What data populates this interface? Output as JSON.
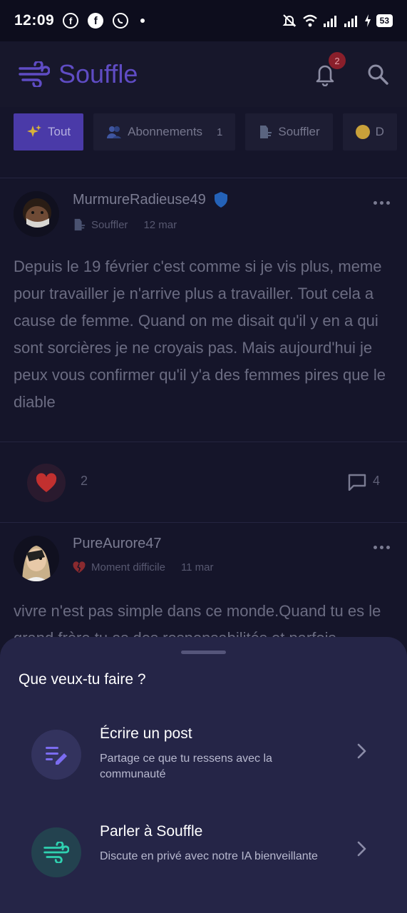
{
  "status_bar": {
    "time": "12:09",
    "battery": "53"
  },
  "header": {
    "title": "Souffle",
    "notification_count": "2"
  },
  "tabs": [
    {
      "label": "Tout",
      "count": ""
    },
    {
      "label": "Abonnements",
      "count": "1"
    },
    {
      "label": "Souffler",
      "count": ""
    },
    {
      "label": "D",
      "count": ""
    }
  ],
  "posts": [
    {
      "author": "MurmureRadieuse49",
      "verified": true,
      "category": "Souffler",
      "date": "12 mar",
      "body": "Depuis le 19 février c'est comme si je vis plus, meme pour travailler je n'arrive plus a travailler. Tout cela a cause de femme. Quand on me disait qu'il y en a qui sont sorcières je ne croyais pas. Mais aujourd'hui je peux vous confirmer qu'il y'a des femmes pires que le diable",
      "likes": "2",
      "comments": "4"
    },
    {
      "author": "PureAurore47",
      "verified": false,
      "category": "Moment difficile",
      "date": "11 mar",
      "body": "vivre n'est pas simple  dans ce monde.Quand tu es le grand frère tu as des responsabilités et parfois"
    }
  ],
  "sheet": {
    "title": "Que veux-tu faire ?",
    "options": [
      {
        "title": "Écrire un post",
        "description": "Partage ce que tu ressens avec la communauté",
        "icon": "edit-list-icon",
        "accent": "#7b6cf0"
      },
      {
        "title": "Parler à Souffle",
        "description": "Discute en privé avec notre IA bienveillante",
        "icon": "wind-icon",
        "accent": "#2fd1b0"
      }
    ]
  },
  "colors": {
    "brand": "#5f4cc4",
    "sheet_bg": "#252547",
    "page_bg": "#15152a"
  }
}
